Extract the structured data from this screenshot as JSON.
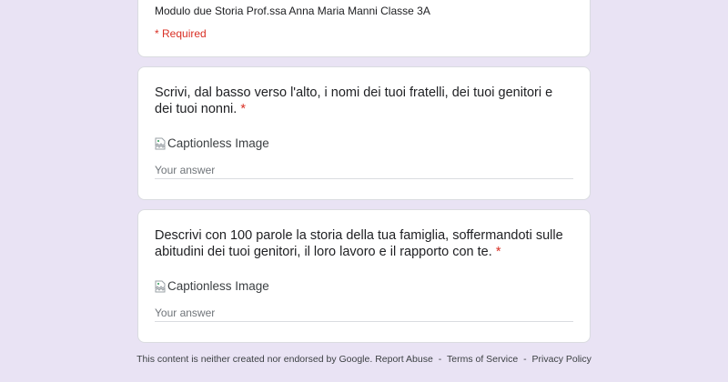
{
  "header": {
    "description": "Modulo due Storia Prof.ssa Anna Maria Manni Classe 3A",
    "required_note": "* Required"
  },
  "questions": [
    {
      "text": "Scrivi, dal basso verso l'alto, i nomi dei tuoi fratelli, dei tuoi genitori e dei tuoi nonni.",
      "required_mark": "*",
      "image_alt": "Captionless Image",
      "answer_placeholder": "Your answer",
      "answer_value": ""
    },
    {
      "text": "Descrivi con 100 parole la storia della tua famiglia, soffermandoti sulle abitudini dei tuoi genitori, il loro lavoro e il rapporto con te.",
      "required_mark": "*",
      "image_alt": "Captionless Image",
      "answer_placeholder": "Your answer",
      "answer_value": ""
    }
  ],
  "footer": {
    "disclaimer": "This content is neither created nor endorsed by Google.",
    "report_abuse": "Report Abuse",
    "terms": "Terms of Service",
    "privacy": "Privacy Policy",
    "separator": "-"
  },
  "colors": {
    "background": "#e9e3f4",
    "required": "#d93025",
    "card_border": "#dadce0"
  },
  "icons": {
    "image_placeholder": "broken-image-icon"
  }
}
